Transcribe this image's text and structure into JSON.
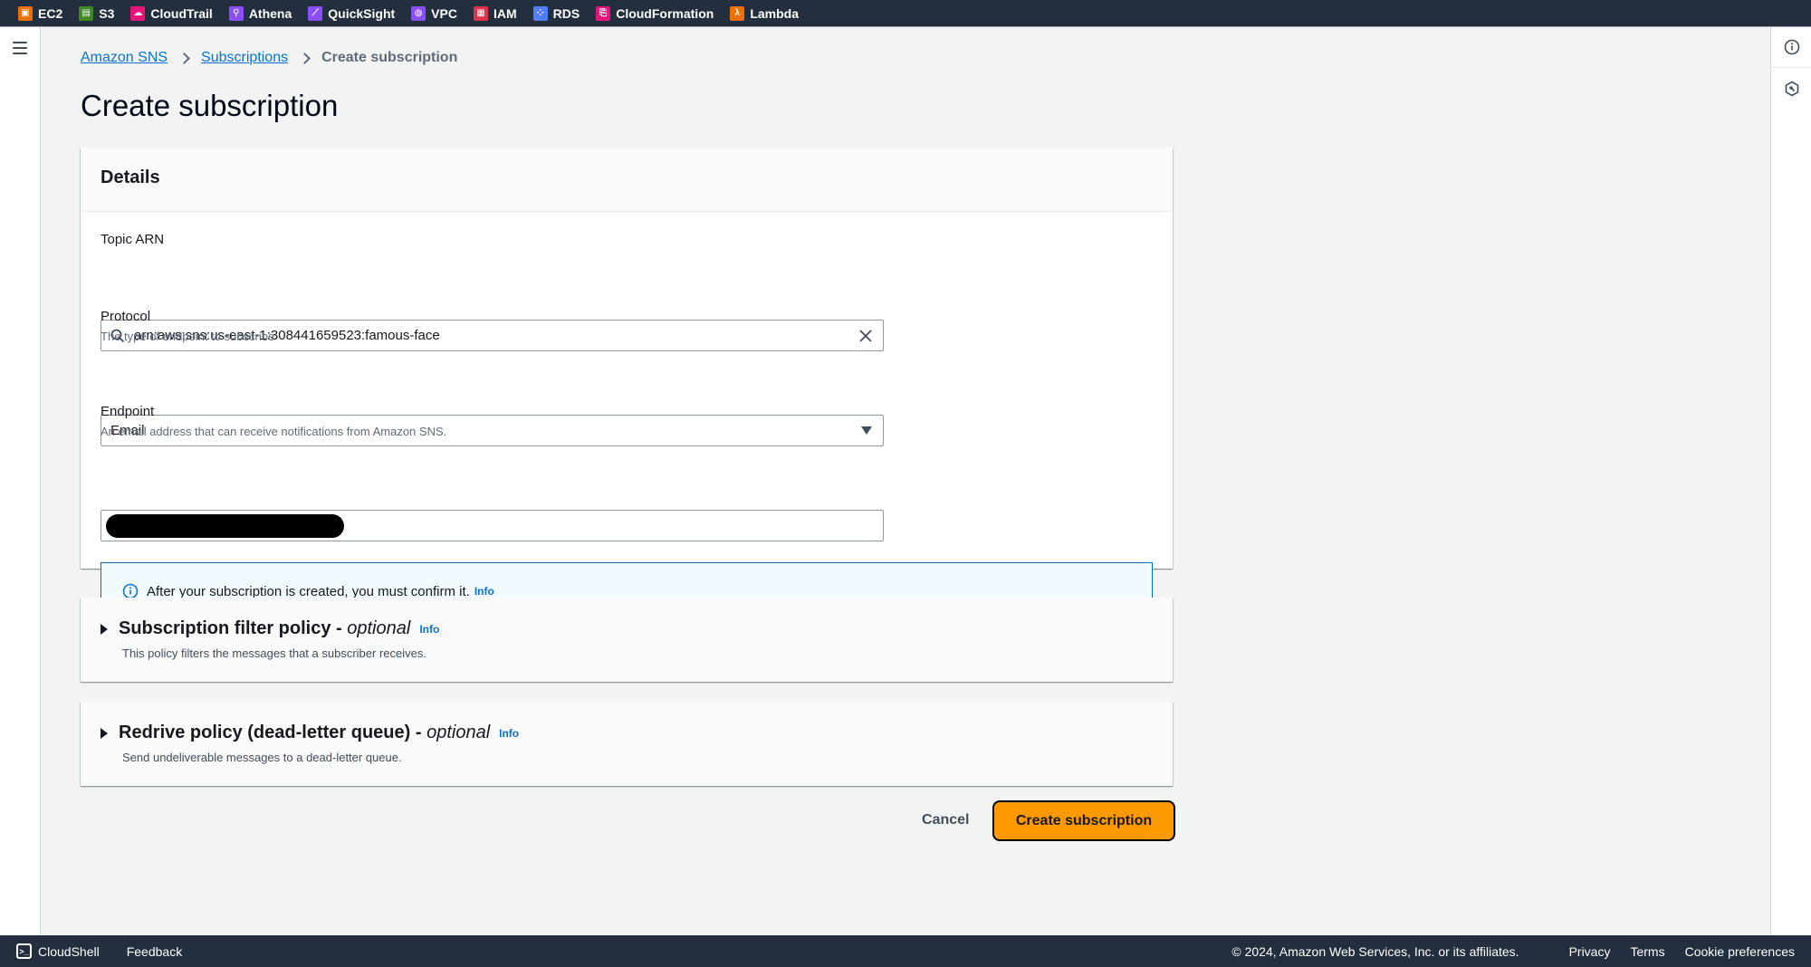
{
  "topbar": {
    "services": [
      {
        "label": "EC2",
        "icon": "ec2-icon",
        "color": "#ed7100",
        "glyph": "▣"
      },
      {
        "label": "S3",
        "icon": "s3-icon",
        "color": "#3f8624",
        "glyph": "▤"
      },
      {
        "label": "CloudTrail",
        "icon": "cloudtrail-icon",
        "color": "#e7157b",
        "glyph": "☁"
      },
      {
        "label": "Athena",
        "icon": "athena-icon",
        "color": "#8c4fff",
        "glyph": "⚲"
      },
      {
        "label": "QuickSight",
        "icon": "quicksight-icon",
        "color": "#8c4fff",
        "glyph": "⟋"
      },
      {
        "label": "VPC",
        "icon": "vpc-icon",
        "color": "#8c4fff",
        "glyph": "◍"
      },
      {
        "label": "IAM",
        "icon": "iam-icon",
        "color": "#dd344c",
        "glyph": "▦"
      },
      {
        "label": "RDS",
        "icon": "rds-icon",
        "color": "#527fff",
        "glyph": "⁘"
      },
      {
        "label": "CloudFormation",
        "icon": "cloudformation-icon",
        "color": "#e7157b",
        "glyph": "⎘"
      },
      {
        "label": "Lambda",
        "icon": "lambda-icon",
        "color": "#ed7100",
        "glyph": "λ"
      }
    ]
  },
  "breadcrumb": {
    "items": [
      "Amazon SNS",
      "Subscriptions"
    ],
    "current": "Create subscription"
  },
  "page": {
    "title": "Create subscription"
  },
  "details": {
    "heading": "Details",
    "topic_arn": {
      "label": "Topic ARN",
      "value": "arn:aws:sns:us-east-1:308441659523:famous-face"
    },
    "protocol": {
      "label": "Protocol",
      "description": "The type of endpoint to subscribe",
      "value": "Email"
    },
    "endpoint": {
      "label": "Endpoint",
      "description": "An email address that can receive notifications from Amazon SNS.",
      "value": "[redacted]"
    },
    "alert": {
      "text": "After your subscription is created, you must confirm it.",
      "link": "Info"
    }
  },
  "filter_policy": {
    "title": "Subscription filter policy - ",
    "optional": "optional",
    "info": "Info",
    "description": "This policy filters the messages that a subscriber receives."
  },
  "redrive_policy": {
    "title": "Redrive policy (dead-letter queue) - ",
    "optional": "optional",
    "info": "Info",
    "description": "Send undeliverable messages to a dead-letter queue."
  },
  "actions": {
    "cancel": "Cancel",
    "create": "Create subscription"
  },
  "footer": {
    "cloudshell": "CloudShell",
    "feedback": "Feedback",
    "copyright": "© 2024, Amazon Web Services, Inc. or its affiliates.",
    "privacy": "Privacy",
    "terms": "Terms",
    "cookies": "Cookie preferences"
  }
}
